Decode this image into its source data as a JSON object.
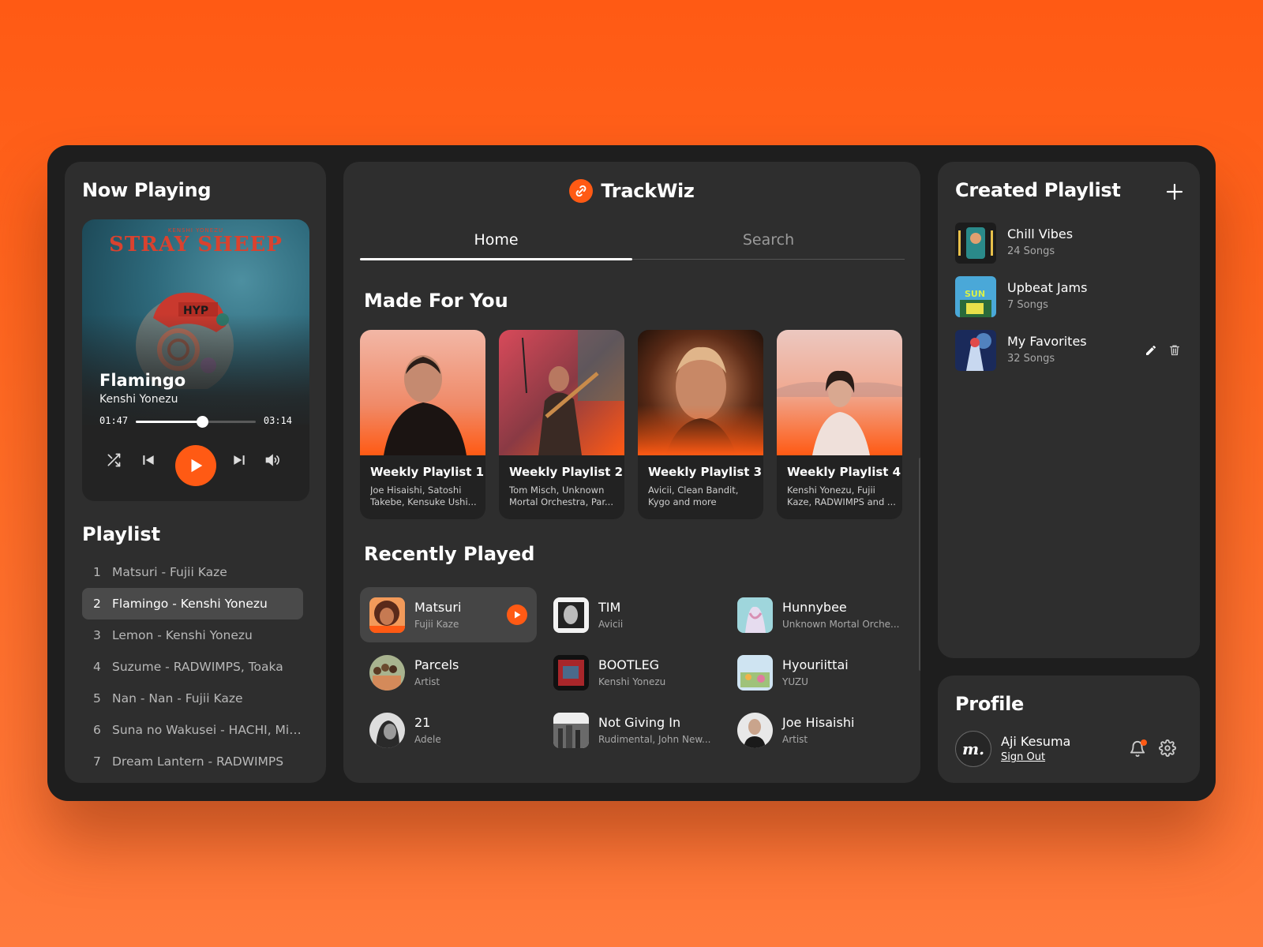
{
  "now_playing": {
    "title": "Now Playing",
    "album_art_text": "STRAY SHEEP",
    "album_art_small": "KENSHI YONEZU",
    "song": "Flamingo",
    "artist": "Kenshi Yonezu",
    "elapsed": "01:47",
    "duration": "03:14",
    "progress": 0.55
  },
  "playlist": {
    "title": "Playlist",
    "items": [
      {
        "num": "1",
        "label": "Matsuri - Fujii Kaze"
      },
      {
        "num": "2",
        "label": "Flamingo - Kenshi Yonezu",
        "active": true
      },
      {
        "num": "3",
        "label": "Lemon - Kenshi Yonezu"
      },
      {
        "num": "4",
        "label": "Suzume - RADWIMPS, Toaka"
      },
      {
        "num": "5",
        "label": "Nan - Nan - Fujii Kaze"
      },
      {
        "num": "6",
        "label": "Suna no Wakusei - HACHI, Mik..."
      },
      {
        "num": "7",
        "label": "Dream Lantern - RADWIMPS"
      }
    ]
  },
  "brand": {
    "name": "TrackWiz"
  },
  "tabs": [
    {
      "label": "Home",
      "active": true
    },
    {
      "label": "Search"
    }
  ],
  "made_for_you": {
    "title": "Made For You",
    "cards": [
      {
        "title": "Weekly Playlist 1",
        "sub": "Joe Hisaishi, Satoshi Takebe, Kensuke Ushi..."
      },
      {
        "title": "Weekly Playlist 2",
        "sub": "Tom Misch, Unknown Mortal Orchestra, Par..."
      },
      {
        "title": "Weekly Playlist 3",
        "sub": "Avicii, Clean Bandit, Kygo and more"
      },
      {
        "title": "Weekly Playlist 4",
        "sub": "Kenshi Yonezu, Fujii Kaze, RADWIMPS and ..."
      }
    ]
  },
  "recently_played": {
    "title": "Recently Played",
    "items": [
      {
        "name": "Matsuri",
        "sub": "Fujii Kaze",
        "active": true
      },
      {
        "name": "TIM",
        "sub": "Avicii"
      },
      {
        "name": "Hunnybee",
        "sub": "Unknown Mortal Orche..."
      },
      {
        "name": "Parcels",
        "sub": "Artist"
      },
      {
        "name": "BOOTLEG",
        "sub": "Kenshi Yonezu"
      },
      {
        "name": "Hyouriittai",
        "sub": "YUZU"
      },
      {
        "name": "21",
        "sub": "Adele"
      },
      {
        "name": "Not Giving In",
        "sub": "Rudimental, John New..."
      },
      {
        "name": "Joe Hisaishi",
        "sub": "Artist"
      }
    ]
  },
  "created_playlist": {
    "title": "Created Playlist",
    "items": [
      {
        "name": "Chill Vibes",
        "count": "24 Songs"
      },
      {
        "name": "Upbeat Jams",
        "count": "7 Songs"
      },
      {
        "name": "My Favorites",
        "count": "32 Songs"
      }
    ]
  },
  "profile": {
    "title": "Profile",
    "avatar_text": "m.",
    "name": "Aji Kesuma",
    "sign_out": "Sign Out"
  },
  "colors": {
    "accent": "#ff5a14",
    "panel": "#2e2e2e",
    "frame": "#1e1e1e"
  }
}
